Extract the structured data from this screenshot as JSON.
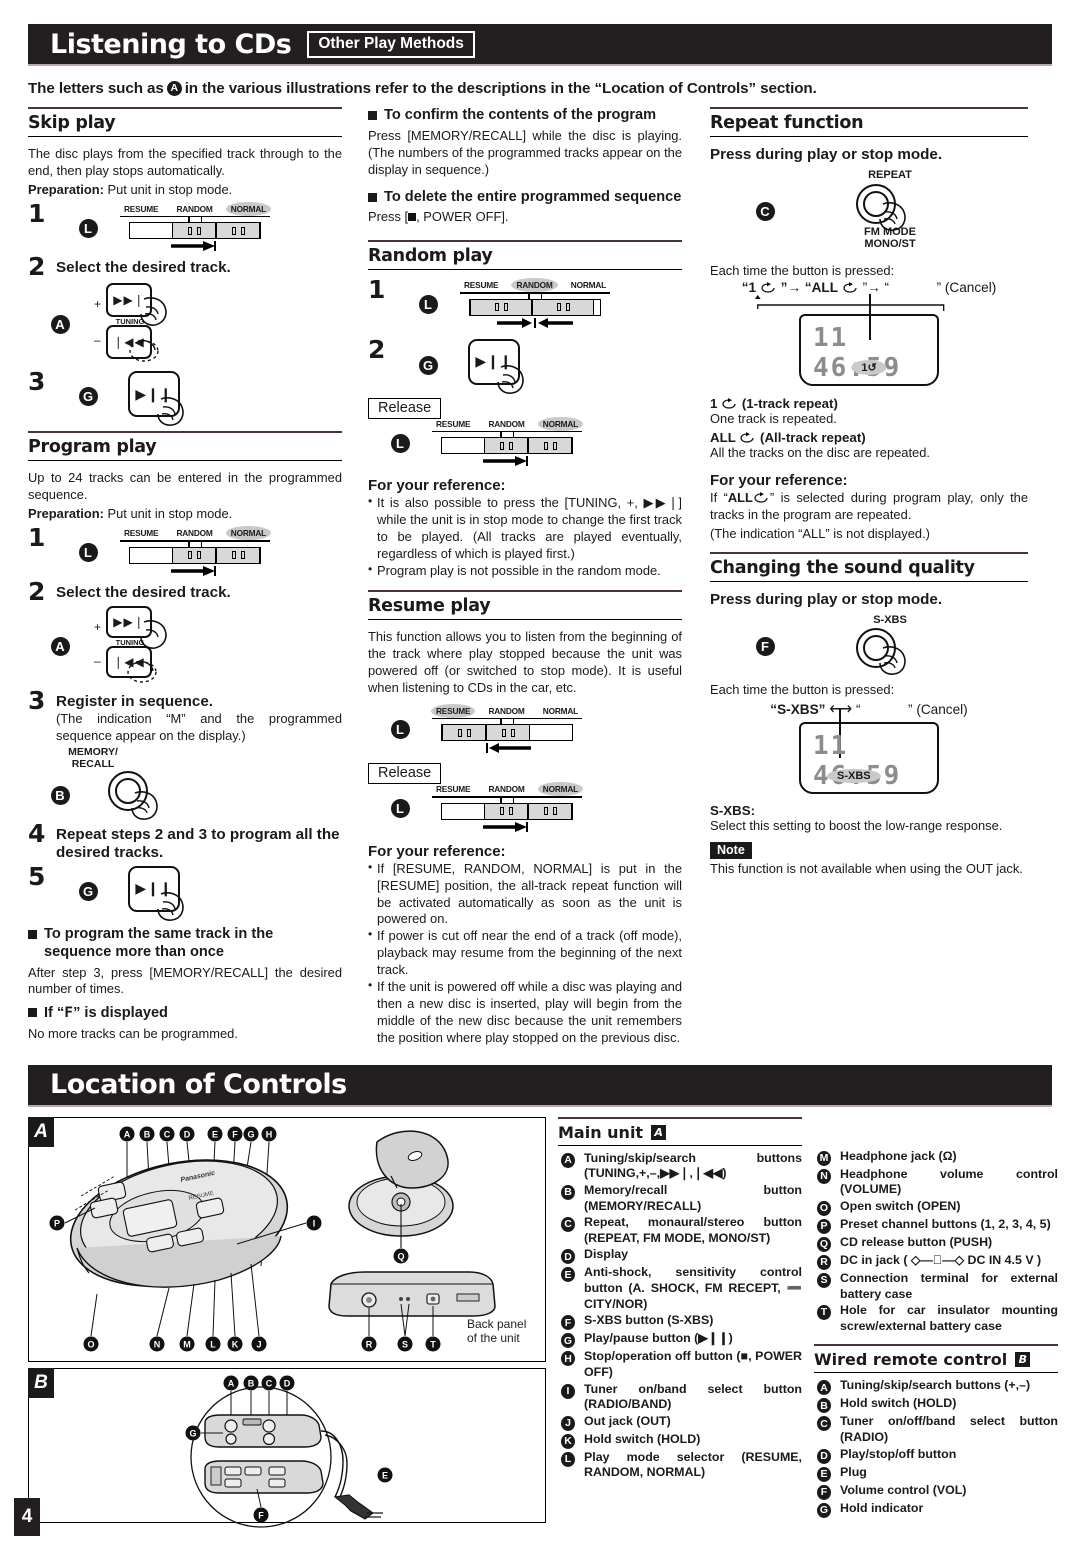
{
  "banners": {
    "top_title": "Listening to CDs",
    "top_tag": "Other Play Methods",
    "bottom_title": "Location of Controls"
  },
  "intro": {
    "before": "The letters such as",
    "badge": "A",
    "after": "in the various illustrations refer to the descriptions in the “Location of Controls” section."
  },
  "col1": {
    "skip": {
      "heading": "Skip play",
      "body": "The disc plays from the specified track through to the end, then play stops automatically.",
      "prep_label": "Preparation:",
      "prep_text": "Put unit in stop mode.",
      "step1_num": "1",
      "step1_badge": "L",
      "step2_num": "2",
      "step2_text": "Select the desired track.",
      "step2_badge": "A",
      "step3_num": "3",
      "step3_badge": "G",
      "switch_labels": [
        "RESUME",
        "RANDOM",
        "NORMAL"
      ],
      "switch_highlight": "NORMAL",
      "tuning_label": "TUNING",
      "plus": "+",
      "minus": "–",
      "ff_glyph": "▶▶❘",
      "rew_glyph": "❘◀◀",
      "play_glyph": "▶❙❙"
    },
    "program": {
      "heading": "Program play",
      "body": "Up to 24 tracks can be entered in the programmed sequence.",
      "prep_label": "Preparation:",
      "prep_text": "Put unit in stop mode.",
      "step1_num": "1",
      "step1_badge": "L",
      "step2_num": "2",
      "step2_text": "Select the desired track.",
      "step2_badge": "A",
      "step3_num": "3",
      "step3_text": "Register in sequence.",
      "step3_note": "(The indication “M” and the programmed sequence appear on the display.)",
      "step3_badge": "B",
      "memory_label_1": "MEMORY/",
      "memory_label_2": "RECALL",
      "step4_num": "4",
      "step4_text": "Repeat steps 2 and 3 to program all the desired tracks.",
      "step5_num": "5",
      "step5_badge": "G",
      "sub1_title": "To program the same track in the sequence more than once",
      "sub1_body": "After step 3, press [MEMORY/RECALL] the desired number of times.",
      "sub2_title_a": "If “",
      "sub2_title_glyph": "F",
      "sub2_title_b": "” is displayed",
      "sub2_body": "No more tracks can be programmed.",
      "switch_labels": [
        "RESUME",
        "RANDOM",
        "NORMAL"
      ],
      "switch_highlight": "NORMAL"
    }
  },
  "col2": {
    "confirm_title": "To confirm the contents of the program",
    "confirm_body": "Press [MEMORY/RECALL] while the disc is playing. (The numbers of the programmed tracks appear on the display in sequence.)",
    "delete_title": "To delete the entire programmed sequence",
    "delete_body_a": "Press [",
    "delete_body_b": ", POWER OFF].",
    "random": {
      "heading": "Random play",
      "step1_num": "1",
      "step1_badge": "L",
      "step2_num": "2",
      "step2_badge": "G",
      "release_label": "Release",
      "release_badge": "L",
      "switch_labels": [
        "RESUME",
        "RANDOM",
        "NORMAL"
      ],
      "switch_highlight_1": "RANDOM",
      "switch_highlight_2": "NORMAL",
      "fyr_title": "For your reference:",
      "fyr_items": [
        "It is also possible to press the [TUNING, +, ▶▶❘] while the unit is in stop mode to change the first track to be played. (All tracks are played eventually, regardless of which is played first.)",
        "Program play is not possible in the random mode."
      ]
    },
    "resume": {
      "heading": "Resume play",
      "body": "This function allows you to listen from the beginning of the track where play stopped because the unit was powered off (or switched to stop mode). It is useful when listening to CDs in the car, etc.",
      "badge1": "L",
      "release_label": "Release",
      "badge2": "L",
      "switch_labels": [
        "RESUME",
        "RANDOM",
        "NORMAL"
      ],
      "switch_highlight_1": "RESUME",
      "switch_highlight_2": "NORMAL",
      "fyr_title": "For your reference:",
      "fyr_items": [
        "If [RESUME, RANDOM, NORMAL] is put in the [RESUME] position, the all-track repeat function will be activated automatically as soon as the unit is powered on.",
        "If power is cut off near the end of a track (off mode), playback may resume from the beginning of the next track.",
        "If the unit is powered off while a disc was playing and then a new disc is inserted, play will begin from the middle of the new disc because the unit remembers the position where play stopped on the previous disc."
      ]
    }
  },
  "col3": {
    "repeat": {
      "heading": "Repeat function",
      "press_line": "Press during play or stop mode.",
      "badge": "C",
      "btn_top_label": "REPEAT",
      "btn_bot_label_1": "FM MODE",
      "btn_bot_label_2": "MONO/ST",
      "each_press": "Each time the button is pressed:",
      "cycle_1": "“1",
      "cycle_2": "”→ “ALL",
      "cycle_3": "”→ “",
      "cycle_4": "” (Cancel)",
      "lcd_digits": "11 46:59",
      "lcd_pill": "1",
      "mode1_label": "1",
      "mode1_name": "(1-track repeat)",
      "mode1_desc": "One track is repeated.",
      "mode2_label": "ALL",
      "mode2_name": "(All-track repeat)",
      "mode2_desc": "All the tracks on the disc are repeated.",
      "fyr_title": "For your reference:",
      "fyr_a": "If “",
      "fyr_b": "ALL",
      "fyr_c": "” is selected during program play, only the tracks in the program are repeated.",
      "fyr_d": "(The indication “ALL” is not displayed.)"
    },
    "sound": {
      "heading": "Changing the sound quality",
      "press_line": "Press during play or stop mode.",
      "badge": "F",
      "btn_label": "S-XBS",
      "each_press": "Each time the button is pressed:",
      "cycle_1": "“S-XBS”",
      "cycle_2": "⟷",
      "cycle_3": "“",
      "cycle_4": "” (Cancel)",
      "lcd_digits": "11 46:59",
      "lcd_pill": "S-XBS",
      "sxbs_label": "S-XBS:",
      "sxbs_desc": "Select this setting to boost the low-range response.",
      "note_tag": "Note",
      "note_text": "This function is not available when using the OUT jack."
    }
  },
  "location": {
    "panelA_tag": "A",
    "panelB_tag": "B",
    "panelA_callouts_top": [
      "A",
      "B",
      "C",
      "D",
      "E",
      "F",
      "G",
      "H"
    ],
    "panelA_callouts_bottom": [
      "O",
      "N",
      "M",
      "L",
      "K",
      "J"
    ],
    "panelA_callout_left": "P",
    "panelA_callout_right": "I",
    "panelA_callout_open": "Q",
    "panelA_back_callouts": [
      "R",
      "S",
      "T"
    ],
    "panelA_back_caption_1": "Back panel",
    "panelA_back_caption_2": "of the unit",
    "panelB_callouts_top": [
      "A",
      "B",
      "C",
      "D"
    ],
    "panelB_callout_left": "G",
    "panelB_callout_right": "E",
    "panelB_callout_bottom": "F",
    "main_unit_heading": "Main unit",
    "main_unit_tag": "A",
    "main_unit_items_col1": [
      {
        "key": "A",
        "text": "Tuning/skip/search buttons (TUNING,+,–,▶▶❘,❘◀◀)"
      },
      {
        "key": "B",
        "text": "Memory/recall button (MEMORY/RECALL)"
      },
      {
        "key": "C",
        "text": "Repeat, monaural/stereo button (REPEAT, FM MODE, MONO/ST)"
      },
      {
        "key": "D",
        "text": "Display"
      },
      {
        "key": "E",
        "text": "Anti-shock, sensitivity control button (A. SHOCK, FM RECEPT, ➖ CITY/NOR)"
      },
      {
        "key": "F",
        "text": "S-XBS button (S-XBS)"
      },
      {
        "key": "G",
        "text": "Play/pause button (▶❙❙)"
      },
      {
        "key": "H",
        "text": "Stop/operation off button (■, POWER OFF)"
      },
      {
        "key": "I",
        "text": "Tuner on/band select button (RADIO/BAND)"
      },
      {
        "key": "J",
        "text": "Out jack (OUT)"
      },
      {
        "key": "K",
        "text": "Hold switch (HOLD)"
      },
      {
        "key": "L",
        "text": "Play mode selector (RESUME, RANDOM, NORMAL)"
      }
    ],
    "main_unit_items_col2": [
      {
        "key": "M",
        "text": "Headphone jack (Ω)"
      },
      {
        "key": "N",
        "text": "Headphone volume control (VOLUME)"
      },
      {
        "key": "O",
        "text": "Open switch (OPEN)"
      },
      {
        "key": "P",
        "text": "Preset channel buttons (1, 2, 3, 4, 5)"
      },
      {
        "key": "Q",
        "text": "CD release button (PUSH)"
      },
      {
        "key": "R",
        "text": "DC in jack ( ◇—⃒—◇ DC IN 4.5 V )"
      },
      {
        "key": "S",
        "text": "Connection terminal for external battery case"
      },
      {
        "key": "T",
        "text": "Hole for car insulator mounting screw/external battery case"
      }
    ],
    "remote_heading": "Wired remote control",
    "remote_tag": "B",
    "remote_items": [
      {
        "key": "A",
        "text": "Tuning/skip/search buttons (+,–)"
      },
      {
        "key": "B",
        "text": "Hold switch (HOLD)"
      },
      {
        "key": "C",
        "text": "Tuner on/off/band select button (RADIO)"
      },
      {
        "key": "D",
        "text": "Play/stop/off button"
      },
      {
        "key": "E",
        "text": "Plug"
      },
      {
        "key": "F",
        "text": "Volume control (VOL)"
      },
      {
        "key": "G",
        "text": "Hold indicator"
      }
    ]
  },
  "page_number": "4"
}
